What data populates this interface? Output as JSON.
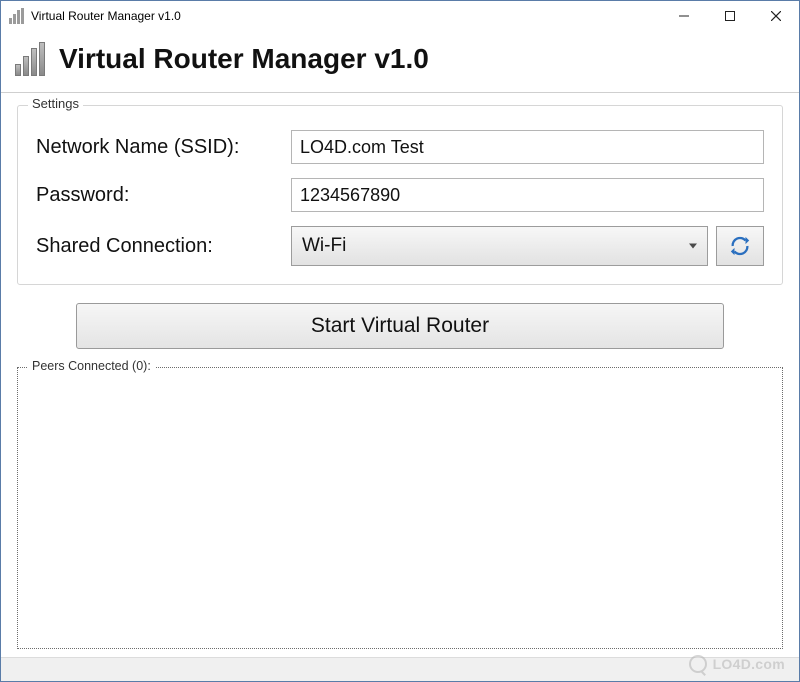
{
  "window": {
    "title": "Virtual Router Manager v1.0"
  },
  "header": {
    "title": "Virtual Router Manager v1.0"
  },
  "settings": {
    "legend": "Settings",
    "ssid_label": "Network Name (SSID):",
    "ssid_value": "LO4D.com Test",
    "password_label": "Password:",
    "password_value": "1234567890",
    "connection_label": "Shared Connection:",
    "connection_value": "Wi-Fi"
  },
  "actions": {
    "start_label": "Start Virtual Router"
  },
  "peers": {
    "legend": "Peers Connected (0):",
    "count": 0
  },
  "watermark": {
    "text": "LO4D.com"
  }
}
